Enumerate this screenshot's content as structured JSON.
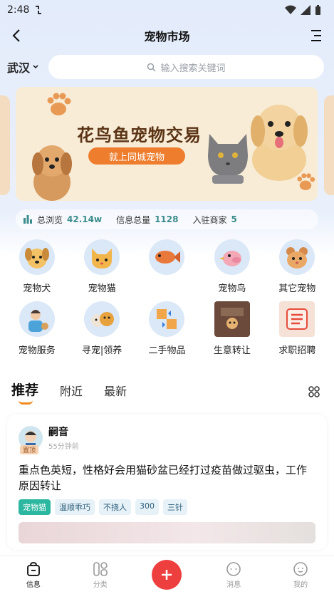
{
  "status_bar": {
    "time": "2:48"
  },
  "header": {
    "title": "宠物市场"
  },
  "search": {
    "city": "武汉",
    "placeholder": "输入搜索关键词"
  },
  "banner": {
    "title": "花鸟鱼宠物交易",
    "subtitle": "就上同城宠物"
  },
  "stats": {
    "views_label": "总浏览",
    "views_value": "42.14w",
    "info_label": "信息总量",
    "info_value": "1128",
    "merchant_label": "入驻商家",
    "merchant_value": "5"
  },
  "categories": [
    {
      "label": "宠物犬"
    },
    {
      "label": "宠物猫"
    },
    {
      "label": ""
    },
    {
      "label": "宠物鸟"
    },
    {
      "label": "其它宠物"
    },
    {
      "label": "宠物服务"
    },
    {
      "label": "寻宠|领养"
    },
    {
      "label": "二手物品"
    },
    {
      "label": "生意转让"
    },
    {
      "label": "求职招聘"
    }
  ],
  "tabs": [
    {
      "label": "推荐"
    },
    {
      "label": "附近"
    },
    {
      "label": "最新"
    }
  ],
  "post": {
    "author": "嗣音",
    "badge": "置顶",
    "time": "55分钟前",
    "text": "重点色英短，性格好会用猫砂盆已经打过疫苗做过驱虫，工作原因转让",
    "tags": [
      "宠物猫",
      "温顺乖巧",
      "不挠人",
      "300",
      "三针"
    ]
  },
  "bottom_nav": [
    {
      "label": "信息"
    },
    {
      "label": "分类"
    },
    {
      "label": ""
    },
    {
      "label": "消息"
    },
    {
      "label": "我的"
    }
  ],
  "colors": {
    "accent": "#f08b1d",
    "stat_value": "#3b8c8c",
    "publish": "#ee3f3f",
    "tag_primary": "#2bb7a0"
  }
}
